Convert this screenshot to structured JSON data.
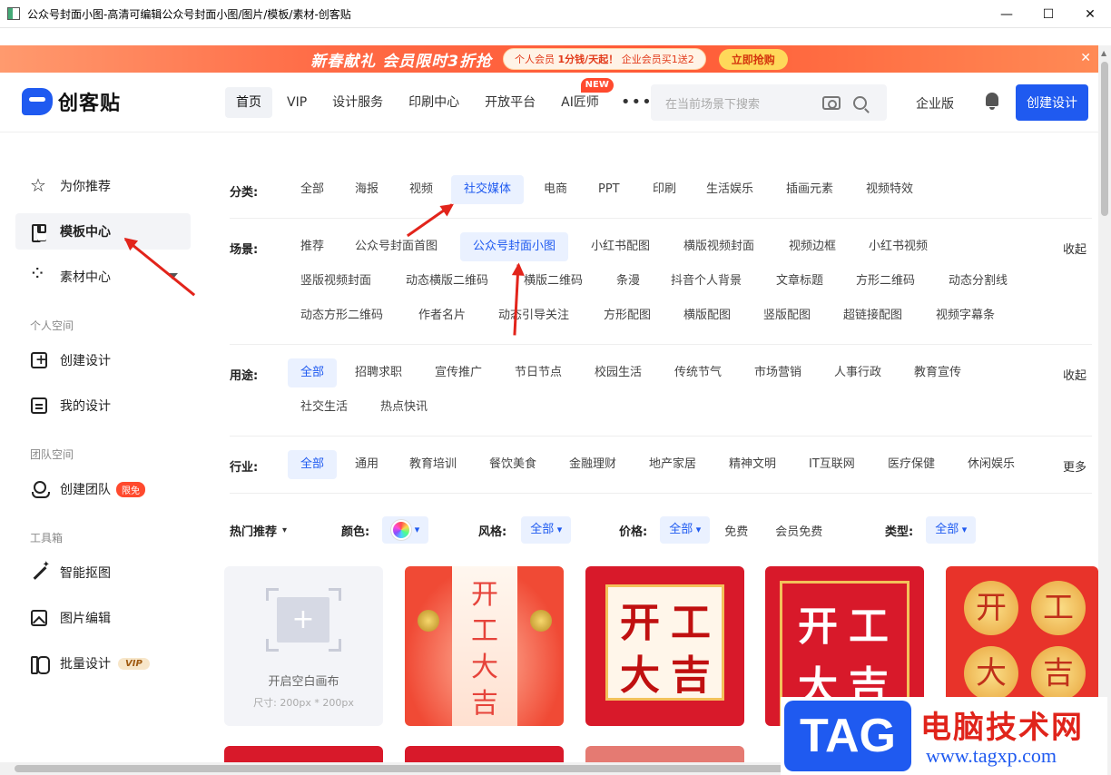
{
  "window": {
    "title": "公众号封面小图-高清可编辑公众号封面小图/图片/模板/素材-创客贴"
  },
  "banner": {
    "headline": "新春献礼 会员限时3折抢",
    "pill_prefix": "个人会员",
    "pill_price": "1分钱/天起！",
    "pill_suffix": "企业会员买1送2",
    "cta": "立即抢购"
  },
  "header": {
    "logo": "创客贴",
    "nav": [
      "首页",
      "VIP",
      "设计服务",
      "印刷中心",
      "开放平台",
      "AI匠师"
    ],
    "new_badge": "NEW",
    "more": "•••",
    "search_placeholder": "在当前场景下搜索",
    "enterprise": "企业版",
    "create": "创建设计"
  },
  "sidebar": {
    "items": [
      "为你推荐",
      "模板中心",
      "素材中心"
    ],
    "personal_title": "个人空间",
    "personal": [
      "创建设计",
      "我的设计"
    ],
    "team_title": "团队空间",
    "team": [
      "创建团队"
    ],
    "team_badge": "限免",
    "tools_title": "工具箱",
    "tools": [
      "智能抠图",
      "图片编辑",
      "批量设计"
    ],
    "vip_badge": "VIP"
  },
  "filters": {
    "category_label": "分类:",
    "categories": [
      "全部",
      "海报",
      "视频",
      "社交媒体",
      "电商",
      "PPT",
      "印刷",
      "生活娱乐",
      "插画元素",
      "视频特效"
    ],
    "scene_label": "场景:",
    "scenes_row1": [
      "推荐",
      "公众号封面首图",
      "公众号封面小图",
      "小红书配图",
      "横版视频封面",
      "视频边框",
      "小红书视频"
    ],
    "scenes_row2": [
      "竖版视频封面",
      "动态横版二维码",
      "横版二维码",
      "条漫",
      "抖音个人背景",
      "文章标题",
      "方形二维码",
      "动态分割线"
    ],
    "scenes_row3": [
      "动态方形二维码",
      "作者名片",
      "动态引导关注",
      "方形配图",
      "横版配图",
      "竖版配图",
      "超链接配图",
      "视频字幕条"
    ],
    "collapse": "收起",
    "usage_label": "用途:",
    "usage_row1": [
      "全部",
      "招聘求职",
      "宣传推广",
      "节日节点",
      "校园生活",
      "传统节气",
      "市场营销",
      "人事行政",
      "教育宣传"
    ],
    "usage_row2": [
      "社交生活",
      "热点快讯"
    ],
    "industry_label": "行业:",
    "industries": [
      "全部",
      "通用",
      "教育培训",
      "餐饮美食",
      "金融理财",
      "地产家居",
      "精神文明",
      "IT互联网",
      "医疗保健",
      "休闲娱乐"
    ],
    "more": "更多"
  },
  "sortbar": {
    "hot": "热门推荐",
    "color_label": "颜色:",
    "style_label": "风格:",
    "style_value": "全部",
    "price_label": "价格:",
    "price_options": [
      "全部",
      "免费",
      "会员免费"
    ],
    "type_label": "类型:",
    "type_value": "全部"
  },
  "cards": {
    "blank_title": "开启空白画布",
    "blank_size": "尺寸: 200px * 200px",
    "t1_text": "开工大吉",
    "t2_chars": [
      "开",
      "工",
      "大",
      "吉"
    ],
    "t3_chars": [
      "开",
      "工",
      "大",
      "吉"
    ],
    "t4_chars": [
      "开",
      "工",
      "大",
      "吉"
    ]
  },
  "watermark": {
    "tag": "TAG",
    "cn": "电脑技术网",
    "url": "www.tagxp.com"
  },
  "colors": {
    "accent": "#1f5af0",
    "banner": "#ff5a36",
    "annotation": "#e2241b"
  }
}
